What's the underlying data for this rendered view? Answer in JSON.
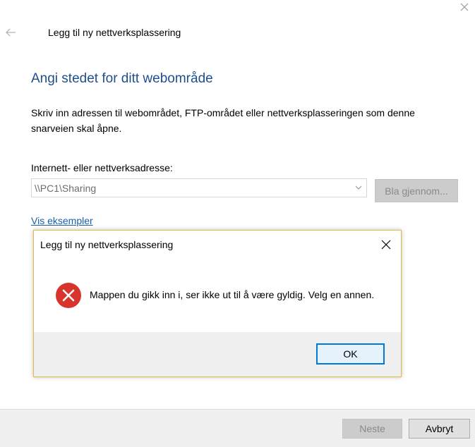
{
  "window": {
    "title": "Legg til ny nettverksplassering"
  },
  "page": {
    "heading": "Angi stedet for ditt webområde",
    "description": "Skriv inn adressen til webområdet, FTP-området eller nettverksplasseringen som denne snarveien skal åpne.",
    "address_label": "Internett- eller nettverksadresse:",
    "address_value": "\\\\PC1\\Sharing",
    "browse_label": "Bla gjennom...",
    "examples_link": "Vis eksempler"
  },
  "footer": {
    "next_label": "Neste",
    "cancel_label": "Avbryt"
  },
  "dialog": {
    "title": "Legg til ny nettverksplassering",
    "message": "Mappen du gikk inn i, ser ikke ut til å være gyldig. Velg en annen.",
    "ok_label": "OK",
    "icon": "error-icon"
  },
  "colors": {
    "heading": "#1f4e8c",
    "link": "#1a5ea8",
    "error": "#d9342b",
    "dialog_border": "#e6b84a",
    "ok_border": "#0078d7"
  }
}
